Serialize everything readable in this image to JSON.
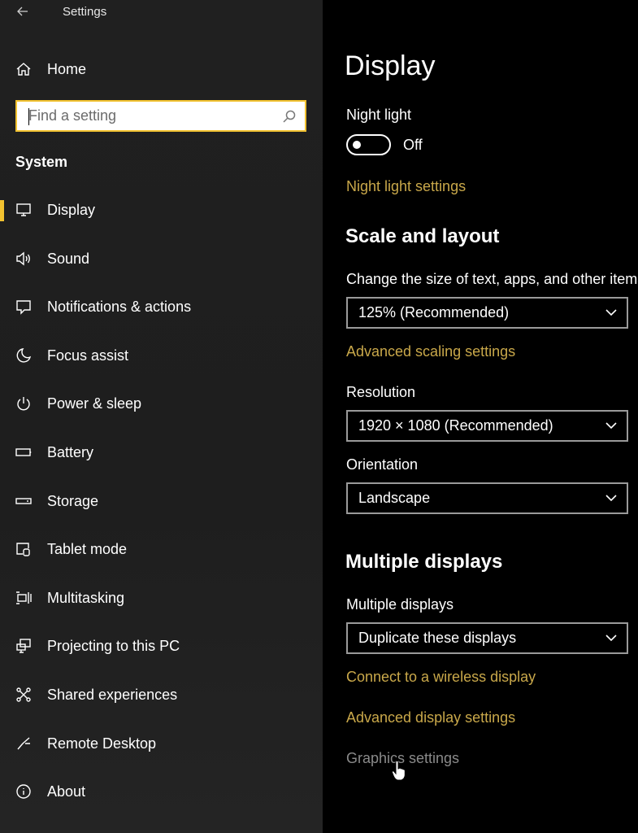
{
  "window": {
    "title": "Settings",
    "back_icon": "back-arrow-icon"
  },
  "sidebar": {
    "home_label": "Home",
    "search": {
      "placeholder": "Find a setting",
      "value": ""
    },
    "section_heading": "System",
    "items": [
      {
        "label": "Display",
        "icon": "monitor-icon",
        "selected": true
      },
      {
        "label": "Sound",
        "icon": "speaker-icon"
      },
      {
        "label": "Notifications & actions",
        "icon": "notification-icon"
      },
      {
        "label": "Focus assist",
        "icon": "moon-icon"
      },
      {
        "label": "Power & sleep",
        "icon": "power-icon"
      },
      {
        "label": "Battery",
        "icon": "battery-icon"
      },
      {
        "label": "Storage",
        "icon": "storage-icon"
      },
      {
        "label": "Tablet mode",
        "icon": "tablet-mode-icon"
      },
      {
        "label": "Multitasking",
        "icon": "multitasking-icon"
      },
      {
        "label": "Projecting to this PC",
        "icon": "projecting-icon"
      },
      {
        "label": "Shared experiences",
        "icon": "shared-experiences-icon"
      },
      {
        "label": "Remote Desktop",
        "icon": "remote-desktop-icon"
      },
      {
        "label": "About",
        "icon": "info-icon"
      }
    ],
    "accent_color": "#f2c230"
  },
  "main": {
    "page_title": "Display",
    "night_light": {
      "label": "Night light",
      "toggle_state": "Off",
      "settings_link": "Night light settings"
    },
    "scale_layout": {
      "heading": "Scale and layout",
      "size_label": "Change the size of text, apps, and other items",
      "size_value": "125% (Recommended)",
      "advanced_link": "Advanced scaling settings",
      "resolution_label": "Resolution",
      "resolution_value": "1920 × 1080 (Recommended)",
      "orientation_label": "Orientation",
      "orientation_value": "Landscape"
    },
    "multiple_displays": {
      "heading": "Multiple displays",
      "label": "Multiple displays",
      "value": "Duplicate these displays",
      "wireless_link": "Connect to a wireless display",
      "advanced_link": "Advanced display settings",
      "graphics_link": "Graphics settings"
    },
    "link_color": "#c9a84a"
  }
}
